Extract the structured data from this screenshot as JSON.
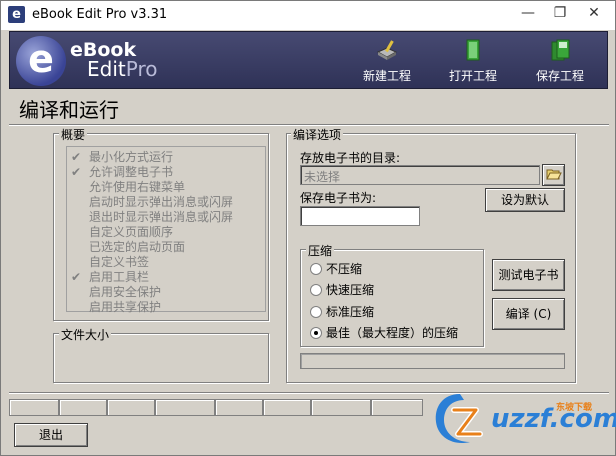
{
  "window": {
    "title": "eBook Edit Pro v3.31",
    "minimize_glyph": "—",
    "restore_glyph": "❐",
    "close_glyph": "✕"
  },
  "banner": {
    "logo_line1": "eBook",
    "logo_line2_a": "Edit",
    "logo_line2_b": "Pro",
    "buttons": [
      {
        "label": "新建工程",
        "icon": "new-project-icon"
      },
      {
        "label": "打开工程",
        "icon": "open-project-icon"
      },
      {
        "label": "保存工程",
        "icon": "save-project-icon"
      }
    ]
  },
  "page": {
    "title": "编译和运行"
  },
  "overview": {
    "title": "概要",
    "items": [
      {
        "label": "最小化方式运行",
        "checked": true
      },
      {
        "label": "允许调整电子书",
        "checked": true
      },
      {
        "label": "允许使用右键菜单",
        "checked": false
      },
      {
        "label": "启动时显示弹出消息或闪屏",
        "checked": false
      },
      {
        "label": "退出时显示弹出消息或闪屏",
        "checked": false
      },
      {
        "label": "自定义页面顺序",
        "checked": false
      },
      {
        "label": "已选定的启动页面",
        "checked": false
      },
      {
        "label": "自定义书签",
        "checked": false
      },
      {
        "label": "启用工具栏",
        "checked": true
      },
      {
        "label": "启用安全保护",
        "checked": false
      },
      {
        "label": "启用共享保护",
        "checked": false
      }
    ],
    "check_glyph": "✔"
  },
  "filesize": {
    "title": "文件大小"
  },
  "compile": {
    "title": "编译选项",
    "dir_label": "存放电子书的目录:",
    "dir_value": "未选择",
    "save_label": "保存电子书为:",
    "save_value": "",
    "set_default_label": "设为默认",
    "compression": {
      "title": "压缩",
      "options": [
        {
          "label": "不压缩",
          "selected": false
        },
        {
          "label": "快速压缩",
          "selected": false
        },
        {
          "label": "标准压缩",
          "selected": false
        },
        {
          "label": "最佳（最大程度）的压缩",
          "selected": true
        }
      ]
    },
    "test_label": "测试电子书",
    "compile_label": "编译 (C)",
    "progress": 0
  },
  "footer": {
    "exit_label": "退出"
  },
  "watermark": {
    "text": "uzzf.com",
    "sub": "东坡下载"
  }
}
